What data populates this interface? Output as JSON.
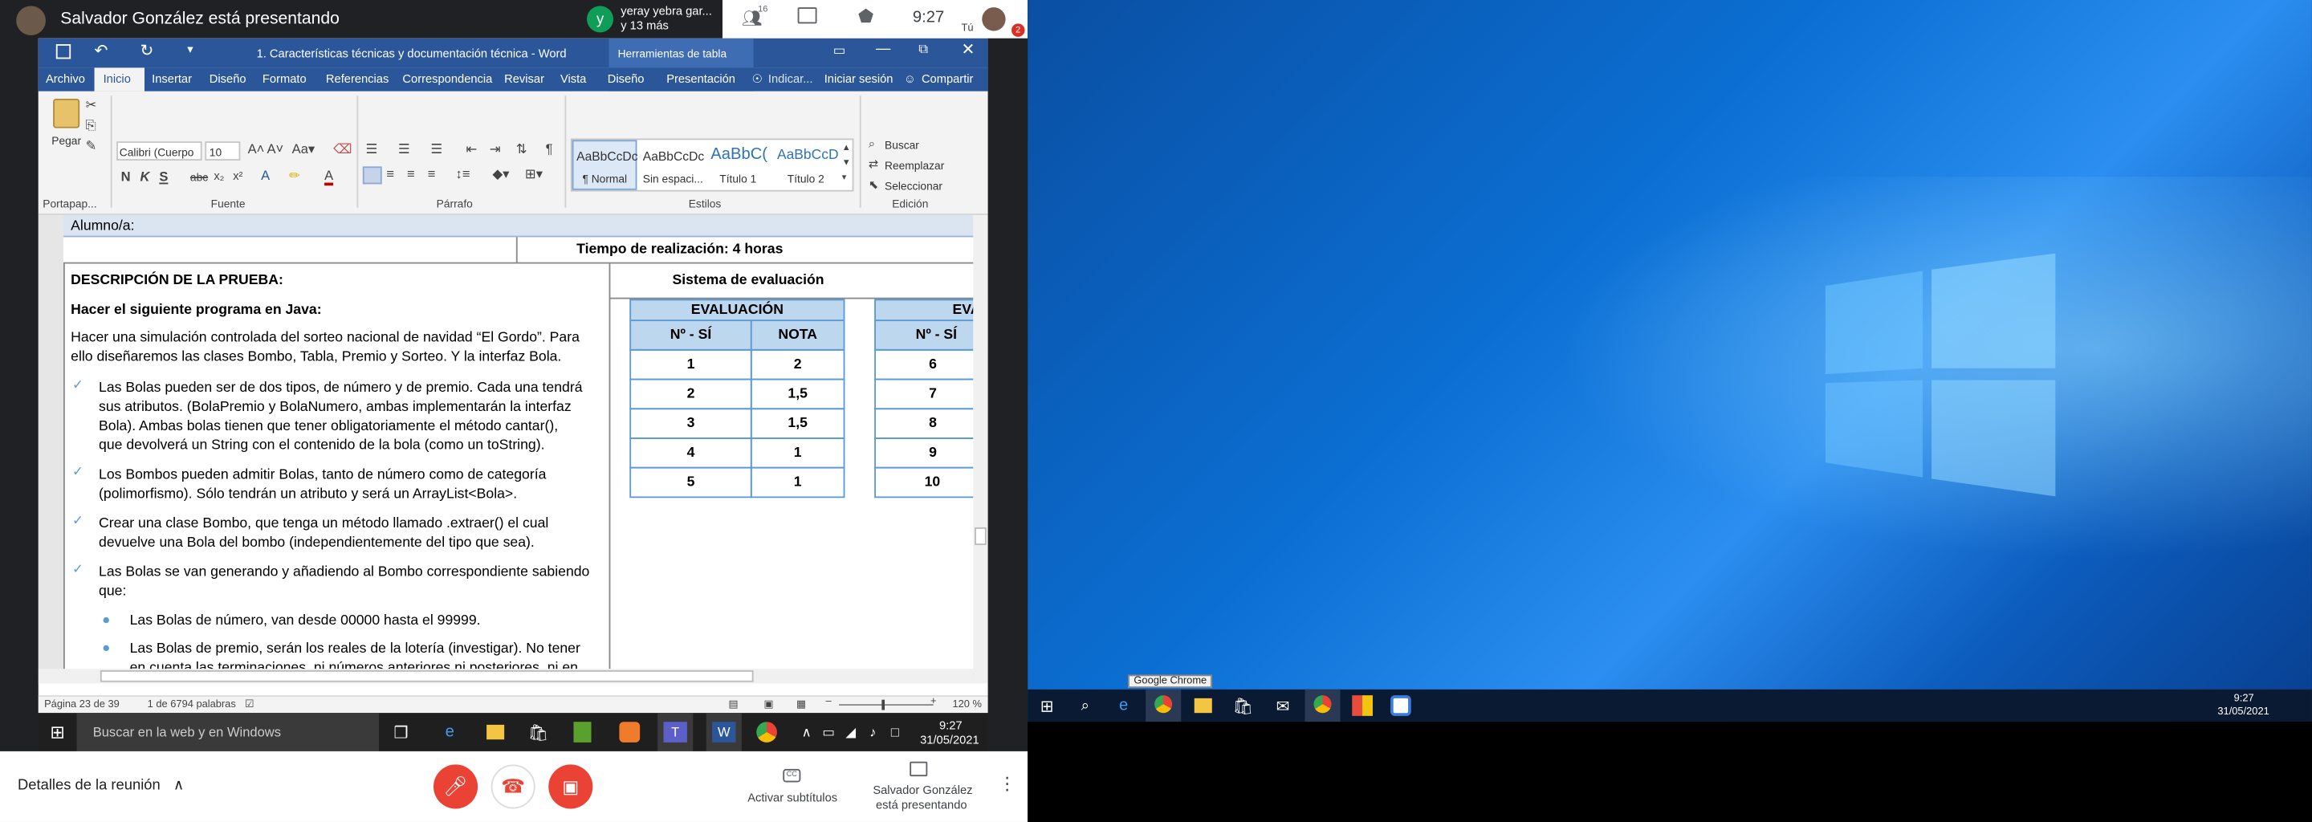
{
  "meet": {
    "presenter_text": "Salvador González está presentando",
    "participant_name": "yeray yebra gar...",
    "participant_more": "y 13 más",
    "participant_initial": "y",
    "people_count": "16",
    "clock": "9:27",
    "you_label": "Tú",
    "notification_count": "2",
    "details_label": "Detalles de la reunión",
    "captions_label": "Activar subtítulos",
    "presenting_label_1": "Salvador González",
    "presenting_label_2": "está presentando"
  },
  "word": {
    "title": "1. Características técnicas y documentación técnica - Word",
    "context_tab": "Herramientas de tabla",
    "tabs": [
      "Archivo",
      "Inicio",
      "Insertar",
      "Diseño",
      "Formato",
      "Referencias",
      "Correspondencia",
      "Revisar",
      "Vista",
      "Diseño",
      "Presentación"
    ],
    "tell_me": "Indicar...",
    "signin": "Iniciar sesión",
    "share": "Compartir",
    "font_name": "Calibri (Cuerpo",
    "font_size": "10",
    "paste_label": "Pegar",
    "group_clipboard": "Portapap...",
    "group_font": "Fuente",
    "group_paragraph": "Párrafo",
    "group_styles": "Estilos",
    "group_editing": "Edición",
    "styles": [
      {
        "preview": "AaBbCcDc",
        "name": "¶ Normal"
      },
      {
        "preview": "AaBbCcDc",
        "name": "Sin espaci..."
      },
      {
        "preview": "AaBbC(",
        "name": "Título 1"
      },
      {
        "preview": "AaBbCcD",
        "name": "Título 2"
      }
    ],
    "find": "Buscar",
    "replace": "Reemplazar",
    "select": "Seleccionar",
    "status_page": "Página 23 de 39",
    "status_words": "1 de 6794 palabras",
    "zoom": "120 %"
  },
  "doc": {
    "student": "Alumno/a:",
    "time": "Tiempo de realización: 4 horas",
    "description": "DESCRIPCIÓN DE LA PRUEBA:",
    "eval_system": "Sistema de evaluación",
    "task": "Hacer el siguiente programa en Java:",
    "intro_1": "Hacer una simulación controlada del sorteo nacional de navidad “El Gordo”. Para",
    "intro_2": "ello diseñaremos las clases Bombo, Tabla, Premio y Sorteo. Y la interfaz Bola.",
    "b1": [
      "Las Bolas pueden ser de dos tipos, de número y de premio. Cada una tendrá",
      "sus atributos. (BolaPremio y BolaNumero, ambas implementarán la interfaz",
      "Bola). Ambas bolas tienen que tener obligatoriamente el método cantar(),",
      "que devolverá un String con el contenido de la bola (como un toString)."
    ],
    "b2": [
      "Los Bombos pueden admitir Bolas, tanto de número como de categoría",
      "(polimorfismo). Sólo tendrán un atributo y será un ArrayList<Bola>."
    ],
    "b3": [
      "Crear una clase Bombo, que tenga un método llamado .extraer() el cual",
      "devuelve una Bola del bombo (independientemente del tipo que sea)."
    ],
    "b4": [
      "Las Bolas se van generando y añadiendo al Bombo correspondiente sabiendo",
      "que:"
    ],
    "sub1": "Las Bolas de número, van desde 00000 hasta el 99999.",
    "sub2": [
      "Las Bolas de premio, serán los reales de la lotería (investigar). No tener",
      "en cuenta las terminaciones, ni números anteriores ni posteriores, ni en"
    ],
    "table": {
      "title": "EVALUACIÓN",
      "col1": "Nº - SÍ",
      "col2": "NOTA",
      "rows": [
        [
          "1",
          "2"
        ],
        [
          "2",
          "1,5"
        ],
        [
          "3",
          "1,5"
        ],
        [
          "4",
          "1"
        ],
        [
          "5",
          "1"
        ]
      ],
      "title2": "EVA",
      "col3": "Nº - SÍ",
      "rows2": [
        "6",
        "7",
        "8",
        "9",
        "10"
      ]
    }
  },
  "taskbar": {
    "search_placeholder": "Buscar en la web y en Windows",
    "time": "9:27",
    "date": "31/05/2021",
    "tooltip": "Google Chrome",
    "time2": "9:27",
    "date2": "31/05/2021"
  }
}
